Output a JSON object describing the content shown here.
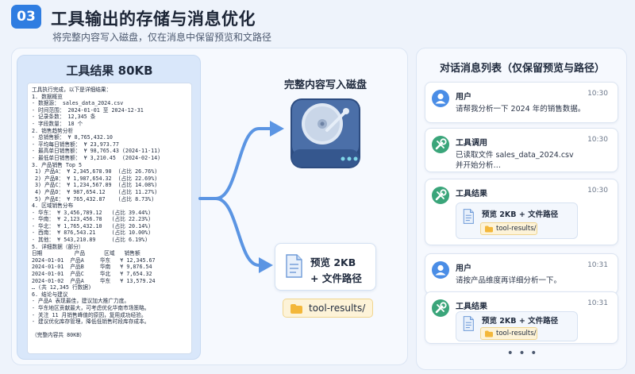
{
  "header": {
    "badge": "03",
    "title": "工具输出的存储与消息优化",
    "subtitle": "将完整内容写入磁盘，仅在消息中保留预览和文路径"
  },
  "tool_result": {
    "title": "工具结果 80KB",
    "lines": [
      "工具执行完成，以下是详细结果：",
      "1. 数据概览",
      "- 数据源： sales_data_2024.csv",
      "- 时间范围： 2024-01-01 至 2024-12-31",
      "- 记录条数： 12,345 条",
      "- 字段数量： 18 个",
      "2. 销售趋势分析",
      "- 总销售额： ¥ 8,765,432.10",
      "- 平均每日销售额： ¥ 23,973.77",
      "- 最高单日销售额： ¥ 98,765.43 (2024-11-11)",
      "- 最低单日销售额： ¥ 3,210.45  (2024-02-14)",
      "3. 产品销售 Top 5",
      " 1) 产品A： ¥ 2,345,678.90  (占比 26.76%)",
      " 2) 产品B： ¥ 1,987,654.32  (占比 22.69%)",
      " 3) 产品C： ¥ 1,234,567.89  (占比 14.08%)",
      " 4) 产品D： ¥ 987,654.12    (占比 11.27%)",
      " 5) 产品E： ¥ 765,432.87    (占比 8.73%)",
      "4. 区域销售分布",
      "- 华东： ¥ 3,456,789.12   (占比 39.44%)",
      "- 华南： ¥ 2,123,456.78   (占比 22.23%)",
      "- 华北： ¥ 1,765,432.10   (占比 20.14%)",
      "- 西南： ¥ 876,543.21     (占比 10.00%)",
      "- 其他： ¥ 543,210.89     (占比 6.19%)",
      "5. 详细数据（部分）",
      "日期          产品      区域   销售额",
      "2024-01-01  产品A     华东   ¥ 12,345.67",
      "2024-01-01  产品B     华南   ¥ 9,876.54",
      "2024-01-01  产品C     华北   ¥ 7,654.32",
      "2024-01-02  产品A     华东   ¥ 13,579.24",
      "… (共 12,345 行数据)",
      "6. 结论与建议",
      "- 产品A 表现最佳，建议加大推广力度。",
      "- 华东地区贡献最大，可考虑优化华南市场策略。",
      "- 关注 11 月销售峰值的原因，复用成功经验。",
      "- 建议优化库存管理，降低低销售时段库存成本。"
    ],
    "footer": "（完整内容共 80KB）"
  },
  "disk": {
    "label": "完整内容写入磁盘"
  },
  "preview": {
    "line1": "预览 2KB",
    "line2": "+ 文件路径",
    "path": "tool-results/"
  },
  "messages_panel": {
    "title": "对话消息列表（仅保留预览与路径）",
    "messages": [
      {
        "role": "用户",
        "time": "10:30",
        "text": [
          "请帮我分析一下 2024 年的销售数据。"
        ]
      },
      {
        "role": "工具调用",
        "time": "10:30",
        "text": [
          "已读取文件 sales_data_2024.csv",
          "并开始分析…"
        ]
      },
      {
        "role": "工具结果",
        "time": "10:30",
        "preview": "预览 2KB + 文件路径",
        "path": "tool-results/"
      },
      {
        "role": "用户",
        "time": "10:31",
        "text": [
          "请按产品维度再详细分析一下。"
        ]
      },
      {
        "role": "工具结果",
        "time": "10:31",
        "preview": "预览 2KB + 文件路径",
        "path": "tool-results/"
      }
    ],
    "more": "• • •"
  },
  "colors": {
    "accent": "#2f7de1",
    "arrow": "#5b95e3",
    "disk_body": "#3d5f99",
    "folder": "#f3b73a",
    "tool_avatar": "#3aa57a"
  }
}
